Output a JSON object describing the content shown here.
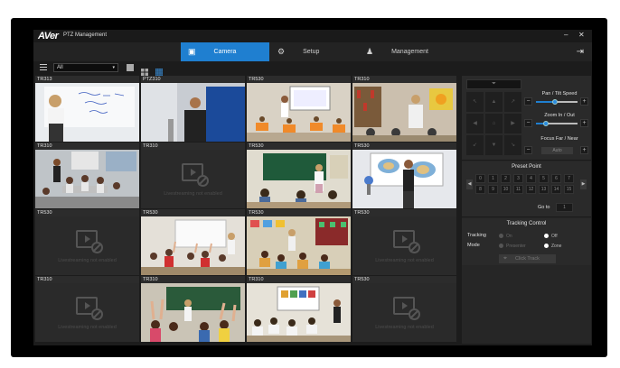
{
  "app": {
    "logo": "AVer",
    "title": "PTZ Management",
    "minimize": "–",
    "close": "✕"
  },
  "nav": {
    "tabs": [
      {
        "label": "Camera",
        "icon": "camera-icon",
        "active": true
      },
      {
        "label": "Setup",
        "icon": "gear-icon",
        "active": false
      },
      {
        "label": "Management",
        "icon": "user-icon",
        "active": false
      }
    ],
    "exit_icon": "exit-icon"
  },
  "toolbar": {
    "group_value": "All",
    "group_arrow": "▾",
    "layouts": [
      "single-view",
      "quad-view",
      "sixteen-view"
    ]
  },
  "grid": {
    "cells": [
      {
        "label": "TR313",
        "streaming": true,
        "scene": "whiteboard"
      },
      {
        "label": "PTZ310",
        "streaming": true,
        "scene": "presenter-blue"
      },
      {
        "label": "TR530",
        "streaming": true,
        "scene": "classroom-screen"
      },
      {
        "label": "TR310",
        "streaming": true,
        "scene": "library-lecture"
      },
      {
        "label": "TR310",
        "streaming": true,
        "scene": "group-class"
      },
      {
        "label": "TR310",
        "streaming": false
      },
      {
        "label": "TR530",
        "streaming": true,
        "scene": "greenboard-teacher"
      },
      {
        "label": "TR530",
        "streaming": true,
        "scene": "map-teacher"
      },
      {
        "label": "TR530",
        "streaming": false
      },
      {
        "label": "TR530",
        "streaming": true,
        "scene": "raised-hands"
      },
      {
        "label": "TR530",
        "streaming": true,
        "scene": "colorful-class"
      },
      {
        "label": "TR530",
        "streaming": false
      },
      {
        "label": "TR310",
        "streaming": false
      },
      {
        "label": "TR310",
        "streaming": true,
        "scene": "hands-up-greenboard"
      },
      {
        "label": "TR310",
        "streaming": true,
        "scene": "class-projector"
      },
      {
        "label": "TR530",
        "streaming": false
      }
    ],
    "off_text": "Livestreaming not enabled"
  },
  "ptz": {
    "display": "⏷",
    "dpad": [
      "↖",
      "▲",
      "↗",
      "◀",
      "⌂",
      "▶",
      "↙",
      "▼",
      "↘"
    ],
    "pan_tilt_label": "Pan / Tilt Speed",
    "zoom_label": "Zoom In / Out",
    "focus_label": "Focus Far / Near",
    "auto_label": "Auto",
    "minus": "−",
    "plus": "+"
  },
  "preset": {
    "title": "Preset Point",
    "points": [
      "0",
      "1",
      "2",
      "3",
      "4",
      "5",
      "6",
      "7",
      "8",
      "9",
      "10",
      "11",
      "12",
      "13",
      "14",
      "15"
    ],
    "prev": "◀",
    "next": "▶",
    "goto_label": "Go to",
    "goto_value": "1"
  },
  "tracking": {
    "title": "Tracking Control",
    "tracking_label": "Tracking",
    "mode_label": "Mode",
    "on": "On",
    "off": "Off",
    "presenter": "Presenter",
    "zone": "Zone",
    "click_track": "Click Track"
  }
}
